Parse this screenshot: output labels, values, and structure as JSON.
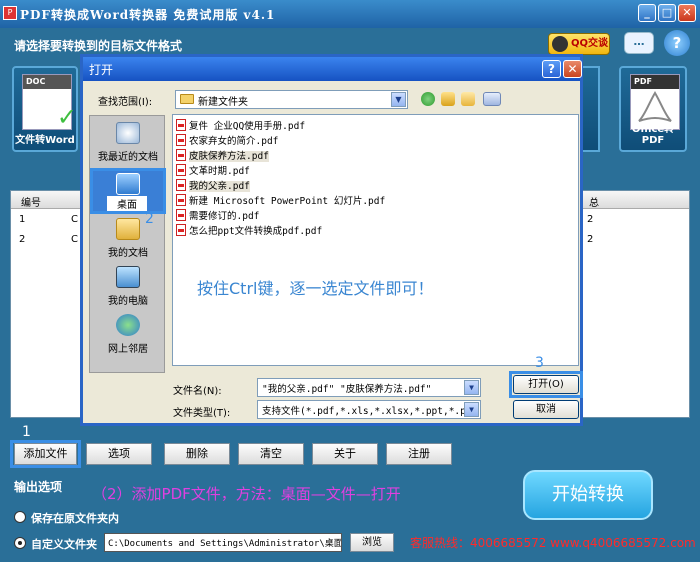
{
  "app": {
    "title": "PDF转换成Word转换器 免费试用版 v4.1",
    "header": "请选择要转换到的目标文件格式",
    "qq_button": "QQ交谈",
    "help_glyph": "?",
    "chat_glyph": "…",
    "minimize_glyph": "_",
    "maximize_glyph": "□",
    "close_glyph": "✕"
  },
  "tiles": {
    "left": {
      "label": "文件转Word",
      "band": "DOC",
      "check": "✓"
    },
    "right": {
      "label": "Office转PDF",
      "band": "PDF"
    }
  },
  "list": {
    "headers": [
      "编号",
      "",
      "总"
    ],
    "rows": [
      {
        "num": "1",
        "col2": "C",
        "col3": "2"
      },
      {
        "num": "2",
        "col2": "C",
        "col3": "2"
      }
    ]
  },
  "buttons": {
    "add_file": "添加文件",
    "options": "选项",
    "delete": "删除",
    "clear": "清空",
    "about": "关于",
    "register": "注册",
    "start": "开始转换"
  },
  "step_labels": {
    "one": "1",
    "two": "2",
    "three": "3"
  },
  "output": {
    "title": "输出选项",
    "keep_original": "保存在原文件夹内",
    "custom_folder": "自定义文件夹",
    "path": "C:\\Documents and Settings\\Administrator\\桌面",
    "browse": "浏览",
    "selected": "custom"
  },
  "instruction_main": "（2）添加PDF文件，方法：桌面—文件—打开",
  "hotline": "客服热线：4006685572  www.q4006685572.com",
  "dialog": {
    "title": "打开",
    "help": "?",
    "close": "✕",
    "look_in_label": "查找范围(I):",
    "look_in_value": "新建文件夹",
    "places": [
      {
        "label": "我最近的文档",
        "icon": "recent-docs-icon"
      },
      {
        "label": "桌面",
        "icon": "desktop-icon"
      },
      {
        "label": "我的文档",
        "icon": "my-documents-icon"
      },
      {
        "label": "我的电脑",
        "icon": "my-computer-icon"
      },
      {
        "label": "网上邻居",
        "icon": "network-icon"
      }
    ],
    "files": [
      {
        "name": "复件 企业QQ使用手册.pdf",
        "selected": false
      },
      {
        "name": "农家弃女的简介.pdf",
        "selected": false
      },
      {
        "name": "皮肤保养方法.pdf",
        "selected": true
      },
      {
        "name": "文革时期.pdf",
        "selected": false
      },
      {
        "name": "我的父亲.pdf",
        "selected": true
      },
      {
        "name": "新建 Microsoft PowerPoint 幻灯片.pdf",
        "selected": false
      },
      {
        "name": "需要修订的.pdf",
        "selected": false
      },
      {
        "name": "怎么把ppt文件转换成pdf.pdf",
        "selected": false
      }
    ],
    "instruction": "按住Ctrl键，逐一选定文件即可！",
    "filename_label": "文件名(N):",
    "filename_value": "\"我的父亲.pdf\" \"皮肤保养方法.pdf\"",
    "filetype_label": "文件类型(T):",
    "filetype_value": "支持文件(*.pdf,*.xls,*.xlsx,*.ppt,*.p",
    "open_button": "打开(O)",
    "cancel_button": "取消"
  },
  "colors": {
    "window_bg": "#2a6f98",
    "title_bar": "#1f63a6",
    "dialog_title": "#1652c2",
    "highlight": "#3a8ee6",
    "hotline": "#ff2a2a",
    "instruction_magenta": "#e040e0",
    "instruction_blue": "#3a86d1"
  }
}
